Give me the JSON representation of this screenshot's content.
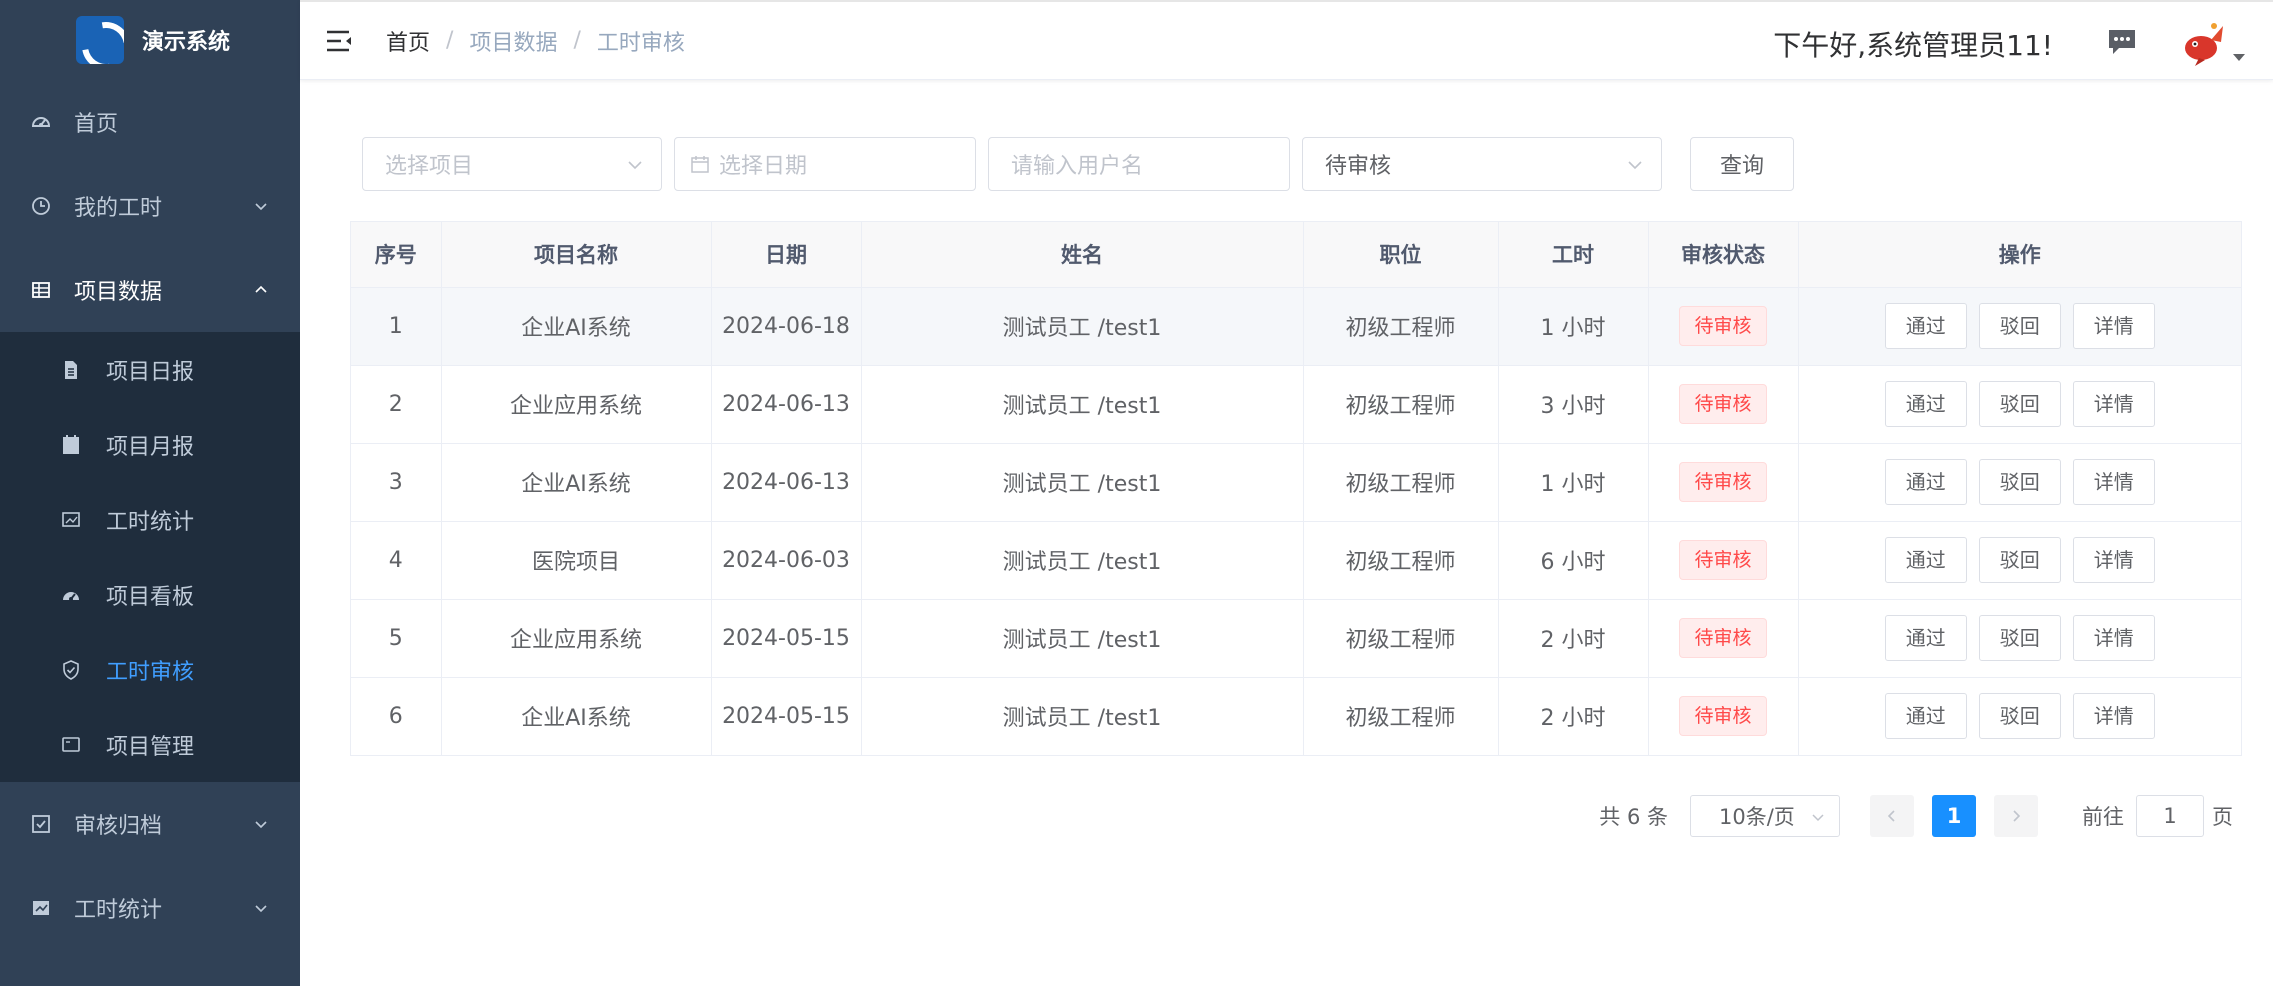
{
  "app": {
    "title": "演示系统"
  },
  "sidebar": {
    "items": [
      {
        "label": "首页",
        "icon": "dashboard-icon"
      },
      {
        "label": "我的工时",
        "icon": "clock-icon",
        "expandable": true,
        "open": false
      },
      {
        "label": "项目数据",
        "icon": "table-icon",
        "expandable": true,
        "open": true,
        "children": [
          {
            "label": "项目日报",
            "icon": "document-icon"
          },
          {
            "label": "项目月报",
            "icon": "calendar-icon"
          },
          {
            "label": "工时统计",
            "icon": "chart-icon"
          },
          {
            "label": "项目看板",
            "icon": "dashboard-icon"
          },
          {
            "label": "工时审核",
            "icon": "shield-icon",
            "active": true
          },
          {
            "label": "项目管理",
            "icon": "monitor-icon"
          }
        ]
      },
      {
        "label": "审核归档",
        "icon": "checkbox-icon",
        "expandable": true,
        "open": false
      },
      {
        "label": "工时统计",
        "icon": "chart-icon",
        "expandable": true,
        "open": false
      }
    ]
  },
  "header": {
    "breadcrumb": [
      "首页",
      "项目数据",
      "工时审核"
    ],
    "greeting": "下午好,系统管理员11!"
  },
  "filters": {
    "project_placeholder": "选择项目",
    "date_placeholder": "选择日期",
    "username_placeholder": "请输入用户名",
    "status_value": "待审核",
    "query_label": "查询"
  },
  "table": {
    "columns": [
      "序号",
      "项目名称",
      "日期",
      "姓名",
      "职位",
      "工时",
      "审核状态",
      "操作"
    ],
    "rows": [
      {
        "index": "1",
        "project": "企业AI系统",
        "date": "2024-06-18",
        "name": "测试员工 /test1",
        "position": "初级工程师",
        "hours": "1 小时",
        "status": "待审核"
      },
      {
        "index": "2",
        "project": "企业应用系统",
        "date": "2024-06-13",
        "name": "测试员工 /test1",
        "position": "初级工程师",
        "hours": "3 小时",
        "status": "待审核"
      },
      {
        "index": "3",
        "project": "企业AI系统",
        "date": "2024-06-13",
        "name": "测试员工 /test1",
        "position": "初级工程师",
        "hours": "1 小时",
        "status": "待审核"
      },
      {
        "index": "4",
        "project": "医院项目",
        "date": "2024-06-03",
        "name": "测试员工 /test1",
        "position": "初级工程师",
        "hours": "6 小时",
        "status": "待审核"
      },
      {
        "index": "5",
        "project": "企业应用系统",
        "date": "2024-05-15",
        "name": "测试员工 /test1",
        "position": "初级工程师",
        "hours": "2 小时",
        "status": "待审核"
      },
      {
        "index": "6",
        "project": "企业AI系统",
        "date": "2024-05-15",
        "name": "测试员工 /test1",
        "position": "初级工程师",
        "hours": "2 小时",
        "status": "待审核"
      }
    ],
    "actions": [
      "通过",
      "驳回",
      "详情"
    ]
  },
  "pagination": {
    "total": "共 6 条",
    "page_size": "10条/页",
    "current_page": "1",
    "goto_label": "前往",
    "goto_value": "1",
    "page_suffix": "页"
  },
  "colors": {
    "sidebar_bg": "#304156",
    "submenu_bg": "#1f2d3d",
    "active": "#409eff",
    "primary": "#1890ff",
    "danger": "#ff4949"
  }
}
